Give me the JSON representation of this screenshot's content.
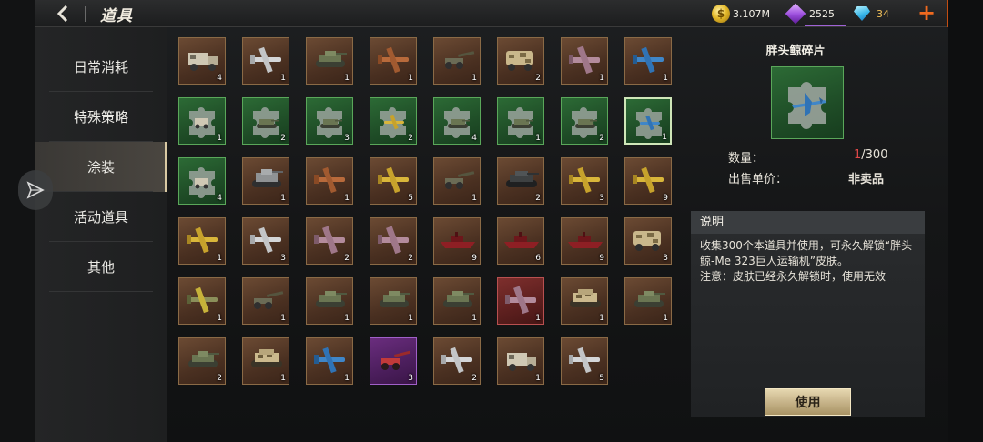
{
  "header": {
    "title": "道具",
    "resources": {
      "coins": "3.107M",
      "gems": "2525",
      "diamonds": "34"
    },
    "plus_label": "+"
  },
  "sidebar": {
    "items": [
      {
        "label": "日常消耗",
        "active": false
      },
      {
        "label": "特殊策略",
        "active": false
      },
      {
        "label": "涂装",
        "active": true
      },
      {
        "label": "活动道具",
        "active": false
      },
      {
        "label": "其他",
        "active": false
      }
    ]
  },
  "grid": {
    "rows": [
      [
        {
          "icon": "truck",
          "rarity": "brown",
          "count": "4"
        },
        {
          "icon": "plane-transport",
          "rarity": "brown",
          "count": "1"
        },
        {
          "icon": "tank",
          "rarity": "brown",
          "count": "1"
        },
        {
          "icon": "plane-fighter",
          "rarity": "brown",
          "count": "1"
        },
        {
          "icon": "artillery",
          "rarity": "brown",
          "count": "1"
        },
        {
          "icon": "truck-camo",
          "rarity": "brown",
          "count": "2"
        },
        {
          "icon": "plane-bomber",
          "rarity": "brown",
          "count": "1"
        },
        {
          "icon": "plane-blue",
          "rarity": "brown",
          "count": "1"
        }
      ],
      [
        {
          "icon": "puzzle-truck",
          "rarity": "green",
          "count": "1"
        },
        {
          "icon": "puzzle-tank",
          "rarity": "green",
          "count": "2"
        },
        {
          "icon": "puzzle-tank",
          "rarity": "green",
          "count": "3"
        },
        {
          "icon": "puzzle-plane",
          "rarity": "green",
          "count": "2"
        },
        {
          "icon": "puzzle-tank",
          "rarity": "green",
          "count": "4"
        },
        {
          "icon": "puzzle-tank",
          "rarity": "green",
          "count": "1"
        },
        {
          "icon": "puzzle-tank",
          "rarity": "green",
          "count": "2"
        },
        {
          "icon": "puzzle-plane-blue",
          "rarity": "green",
          "count": "1",
          "selected": true
        }
      ],
      [
        {
          "icon": "puzzle-truck",
          "rarity": "green",
          "count": "4"
        },
        {
          "icon": "tank-grey",
          "rarity": "brown",
          "count": "1"
        },
        {
          "icon": "plane-fighter",
          "rarity": "brown",
          "count": "1"
        },
        {
          "icon": "plane-yellow",
          "rarity": "brown",
          "count": "5"
        },
        {
          "icon": "artillery",
          "rarity": "brown",
          "count": "1"
        },
        {
          "icon": "tank-dark",
          "rarity": "brown",
          "count": "2"
        },
        {
          "icon": "plane-yellow",
          "rarity": "brown",
          "count": "3"
        },
        {
          "icon": "plane-yellow",
          "rarity": "brown",
          "count": "9"
        }
      ],
      [
        {
          "icon": "plane-yellow",
          "rarity": "brown",
          "count": "1"
        },
        {
          "icon": "plane-transport",
          "rarity": "brown",
          "count": "3"
        },
        {
          "icon": "plane-bomber",
          "rarity": "brown",
          "count": "2"
        },
        {
          "icon": "plane-bomber",
          "rarity": "brown",
          "count": "2"
        },
        {
          "icon": "ship",
          "rarity": "brown",
          "count": "9"
        },
        {
          "icon": "ship",
          "rarity": "brown",
          "count": "6"
        },
        {
          "icon": "ship",
          "rarity": "brown",
          "count": "9"
        },
        {
          "icon": "truck-camo",
          "rarity": "brown",
          "count": "3"
        }
      ],
      [
        {
          "icon": "plane-camo",
          "rarity": "brown",
          "count": "1"
        },
        {
          "icon": "artillery",
          "rarity": "brown",
          "count": "1"
        },
        {
          "icon": "tank",
          "rarity": "brown",
          "count": "1"
        },
        {
          "icon": "tank",
          "rarity": "brown",
          "count": "1"
        },
        {
          "icon": "tank",
          "rarity": "brown",
          "count": "1"
        },
        {
          "icon": "plane-bomber",
          "rarity": "red",
          "count": "1"
        },
        {
          "icon": "tank-camo",
          "rarity": "brown",
          "count": "1"
        },
        {
          "icon": "tank",
          "rarity": "brown",
          "count": "1"
        }
      ],
      [
        {
          "icon": "tank",
          "rarity": "brown",
          "count": "2"
        },
        {
          "icon": "tank-camo",
          "rarity": "brown",
          "count": "1"
        },
        {
          "icon": "plane-blue",
          "rarity": "brown",
          "count": "1"
        },
        {
          "icon": "artillery-red",
          "rarity": "purple",
          "count": "3"
        },
        {
          "icon": "plane-transport",
          "rarity": "brown",
          "count": "2"
        },
        {
          "icon": "truck",
          "rarity": "brown",
          "count": "1"
        },
        {
          "icon": "plane-transport",
          "rarity": "brown",
          "count": "5"
        }
      ]
    ]
  },
  "detail": {
    "name": "胖头鲸碎片",
    "quantity_label": "数量：",
    "quantity_current": "1",
    "quantity_total": "/300",
    "price_label": "出售单价：",
    "price_value": "非卖品",
    "desc_header": "说明",
    "desc_text": "收集300个本道具并使用，可永久解锁“胖头鲸-Me 323巨人运输机”皮肤。\n注意：皮肤已经永久解锁时，使用无效",
    "use_button": "使用"
  },
  "colors": {
    "rarity_brown": "#6b4a33",
    "rarity_green": "#2c6a35",
    "rarity_red": "#7e2f2d",
    "rarity_purple": "#6a2d7e",
    "accent_gold": "#d9c9a3",
    "qty_red": "#e04848"
  }
}
